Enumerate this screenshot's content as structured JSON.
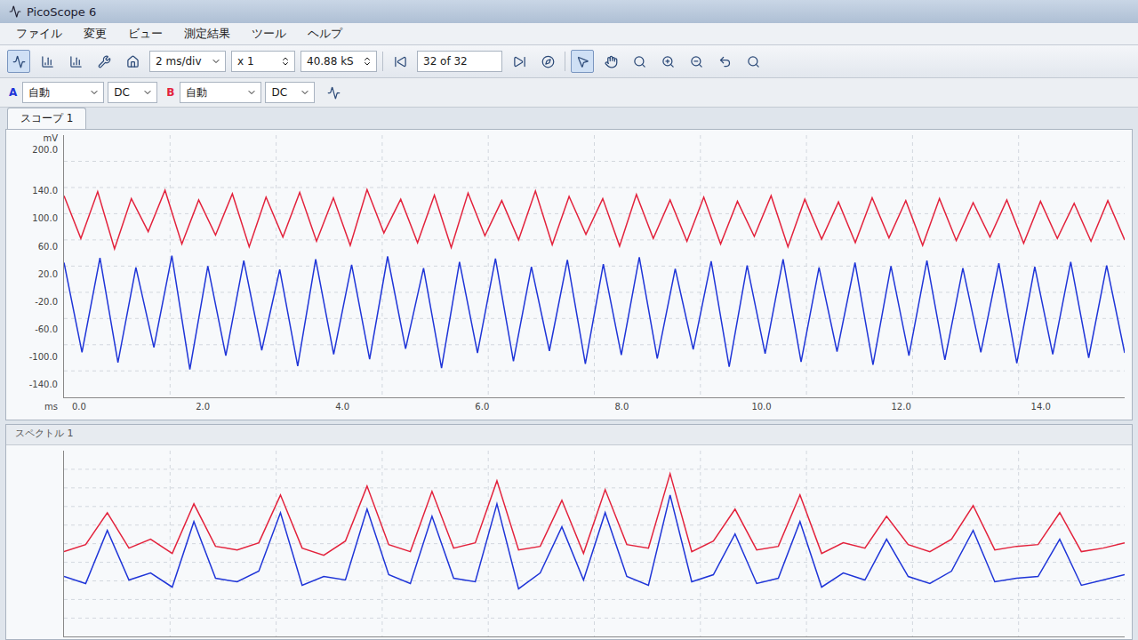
{
  "window": {
    "title": "PicoScope 6"
  },
  "menu": [
    "ファイル",
    "変更",
    "ビュー",
    "測定結果",
    "ツール",
    "ヘルプ"
  ],
  "toolbar": {
    "timebase": "2 ms/div",
    "zoom": "x 1",
    "samples": "40.88 kS",
    "buffer": "32 of 32"
  },
  "channels": [
    {
      "name": "A",
      "range": "自動",
      "coupling": "DC",
      "color": "#1f35d8"
    },
    {
      "name": "B",
      "range": "自動",
      "coupling": "DC",
      "color": "#e3223c"
    }
  ],
  "tabs": [
    {
      "label": "スコープ 1",
      "selected": true
    }
  ],
  "scope": {
    "unit": "mV",
    "x_unit": "ms",
    "y_range": [
      -160,
      220
    ],
    "x_range": [
      0,
      15.2
    ],
    "y_ticks": [
      "200.0",
      "140.0",
      "100.0",
      "60.0",
      "20.0",
      "-20.0",
      "-60.0",
      "-100.0",
      "-140.0"
    ],
    "x_ticks": [
      "0.0",
      "2.0",
      "4.0",
      "6.0",
      "8.0",
      "10.0",
      "12.0",
      "14.0"
    ],
    "series": [
      {
        "channel": "A",
        "color": "#1f35d8",
        "values": [
          35,
          -95,
          42,
          -110,
          28,
          -88,
          45,
          -120,
          30,
          -100,
          38,
          -92,
          25,
          -115,
          40,
          -98,
          32,
          -105,
          44,
          -90,
          27,
          -118,
          36,
          -96,
          41,
          -108,
          29,
          -93,
          39,
          -112,
          33,
          -99,
          43,
          -104,
          26,
          -91,
          37,
          -116,
          31,
          -97,
          40,
          -109,
          28,
          -94,
          35,
          -113,
          30,
          -100,
          38,
          -106,
          27,
          -95,
          34,
          -111,
          29,
          -98,
          36,
          -103,
          31,
          -96
        ]
      },
      {
        "channel": "B",
        "color": "#e3223c",
        "values": [
          132,
          70,
          138,
          55,
          128,
          80,
          140,
          62,
          126,
          75,
          135,
          58,
          130,
          72,
          137,
          66,
          129,
          60,
          141,
          78,
          127,
          64,
          133,
          57,
          136,
          74,
          125,
          68,
          139,
          61,
          131,
          76,
          128,
          59,
          134,
          70,
          126,
          66,
          130,
          62,
          124,
          73,
          132,
          58,
          127,
          69,
          123,
          64,
          129,
          71,
          125,
          60,
          128,
          67,
          122,
          72,
          126,
          63,
          124,
          70,
          121,
          66,
          125,
          68
        ]
      }
    ]
  },
  "spectrum": {
    "title": "スペクトル 1",
    "y_range": [
      -110,
      -5
    ],
    "series": [
      {
        "channel": "A",
        "color": "#1f35d8",
        "values": [
          -76,
          -80,
          -50,
          -78,
          -74,
          -82,
          -45,
          -77,
          -79,
          -73,
          -40,
          -81,
          -76,
          -78,
          -38,
          -75,
          -80,
          -42,
          -77,
          -79,
          -35,
          -83,
          -74,
          -48,
          -78,
          -40,
          -76,
          -81,
          -30,
          -79,
          -75,
          -52,
          -80,
          -77,
          -45,
          -82,
          -74,
          -78,
          -55,
          -76,
          -80,
          -73,
          -50,
          -79,
          -77,
          -76,
          -55,
          -81,
          -78,
          -75
        ]
      },
      {
        "channel": "B",
        "color": "#e3223c",
        "values": [
          -62,
          -58,
          -40,
          -60,
          -55,
          -63,
          -35,
          -59,
          -61,
          -57,
          -30,
          -60,
          -64,
          -56,
          -25,
          -58,
          -62,
          -28,
          -60,
          -57,
          -22,
          -61,
          -59,
          -33,
          -63,
          -27,
          -58,
          -60,
          -18,
          -62,
          -56,
          -38,
          -61,
          -59,
          -30,
          -63,
          -57,
          -60,
          -42,
          -58,
          -62,
          -55,
          -36,
          -61,
          -59,
          -58,
          -40,
          -62,
          -60,
          -57
        ]
      }
    ]
  }
}
